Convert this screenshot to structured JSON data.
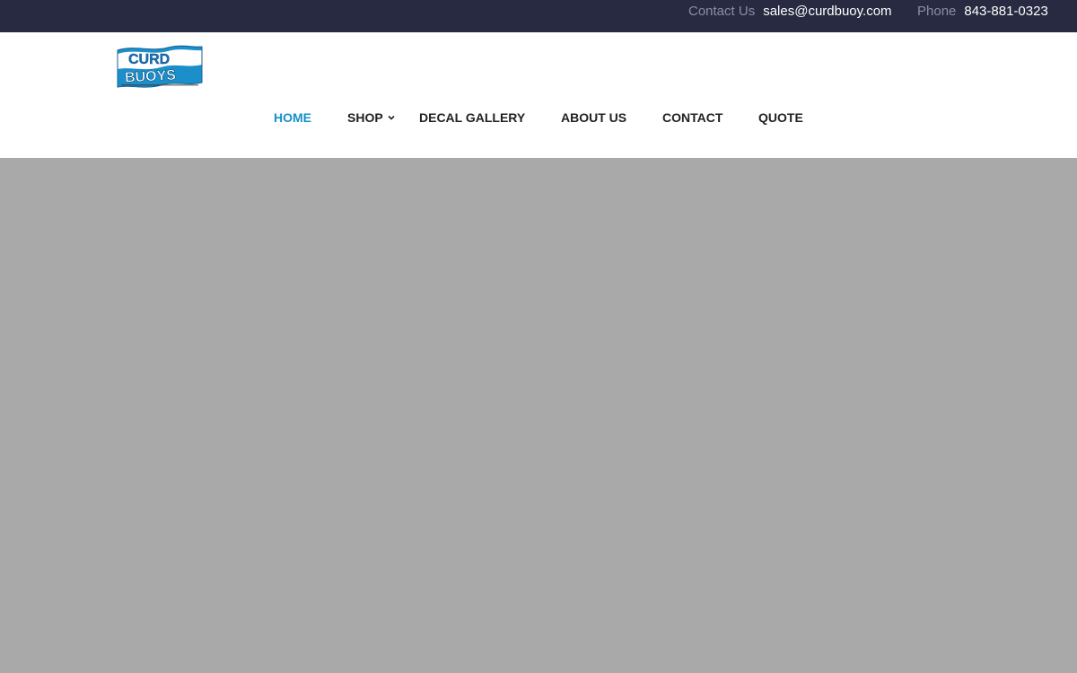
{
  "topbar": {
    "email_label": "Contact Us",
    "email_value": "sales@curdbuoy.com",
    "phone_label": "Phone",
    "phone_value": "843-881-0323"
  },
  "logo": {
    "line1": "CURD",
    "line2": "BUOYS"
  },
  "nav": {
    "items": [
      {
        "label": "HOME",
        "active": true
      },
      {
        "label": "SHOP",
        "has_dropdown": true
      },
      {
        "label": "DECAL GALLERY"
      },
      {
        "label": "ABOUT US"
      },
      {
        "label": "CONTACT"
      },
      {
        "label": "QUOTE"
      }
    ]
  },
  "colors": {
    "topbar_bg": "#272a40",
    "accent": "#1490c8",
    "nav_text": "#222222",
    "hero_bg": "#a9a9a9"
  }
}
